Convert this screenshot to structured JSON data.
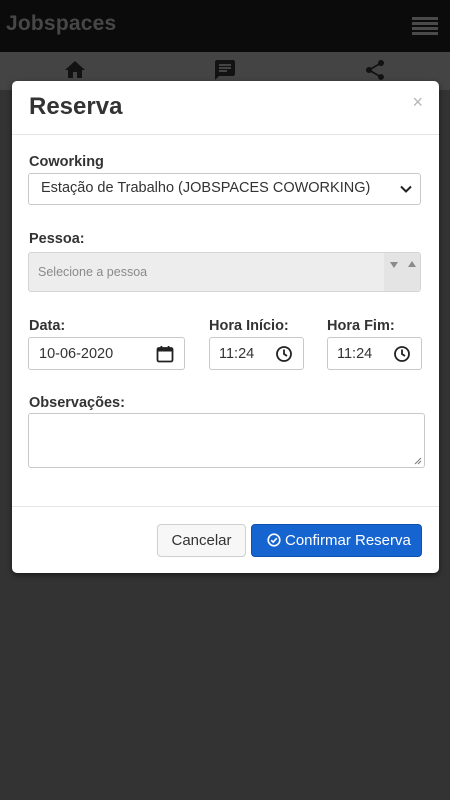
{
  "app": {
    "title": "Jobspaces",
    "nav": [
      "home-icon",
      "chat-icon",
      "share-icon"
    ]
  },
  "modal": {
    "title": "Reserva",
    "close_label": "×",
    "coworking": {
      "label": "Coworking",
      "value": "Estação de Trabalho (JOBSPACES COWORKING)"
    },
    "pessoa": {
      "label": "Pessoa:",
      "placeholder": "Selecione a pessoa"
    },
    "data": {
      "label": "Data:",
      "value": "10-06-2020"
    },
    "hora_inicio": {
      "label": "Hora Início:",
      "value": "11:24"
    },
    "hora_fim": {
      "label": "Hora Fim:",
      "value": "11:24"
    },
    "observacoes": {
      "label": "Observações:",
      "value": ""
    },
    "buttons": {
      "cancel": "Cancelar",
      "confirm": "Confirmar Reserva"
    }
  },
  "colors": {
    "primary": "#1564d0",
    "backdrop": "#303030"
  }
}
